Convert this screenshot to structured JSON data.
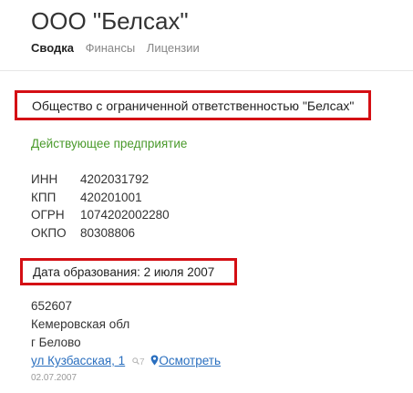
{
  "company": {
    "title": "ООО \"Белсах\"",
    "full_name": "Общество с ограниченной ответственностью \"Белсах\"",
    "status": "Действующее предприятие",
    "founded": "Дата образования: 2 июля 2007"
  },
  "tabs": [
    {
      "label": "Сводка",
      "active": true
    },
    {
      "label": "Финансы",
      "active": false
    },
    {
      "label": "Лицензии",
      "active": false
    }
  ],
  "codes": [
    {
      "label": "ИНН",
      "value": "4202031792"
    },
    {
      "label": "КПП",
      "value": "420201001"
    },
    {
      "label": "ОГРН",
      "value": "1074202002280"
    },
    {
      "label": "ОКПО",
      "value": "80308806"
    }
  ],
  "address": {
    "postcode": "652607",
    "region": "Кемеровская обл",
    "city": "г Белово",
    "street": "ул Кузбасская, 1",
    "search_count": "7",
    "map_link": "Осмотреть",
    "date": "02.07.2007"
  },
  "colors": {
    "highlight_border": "#d40f14",
    "status_green": "#4a9a2b",
    "link_blue": "#2a6fbf"
  }
}
